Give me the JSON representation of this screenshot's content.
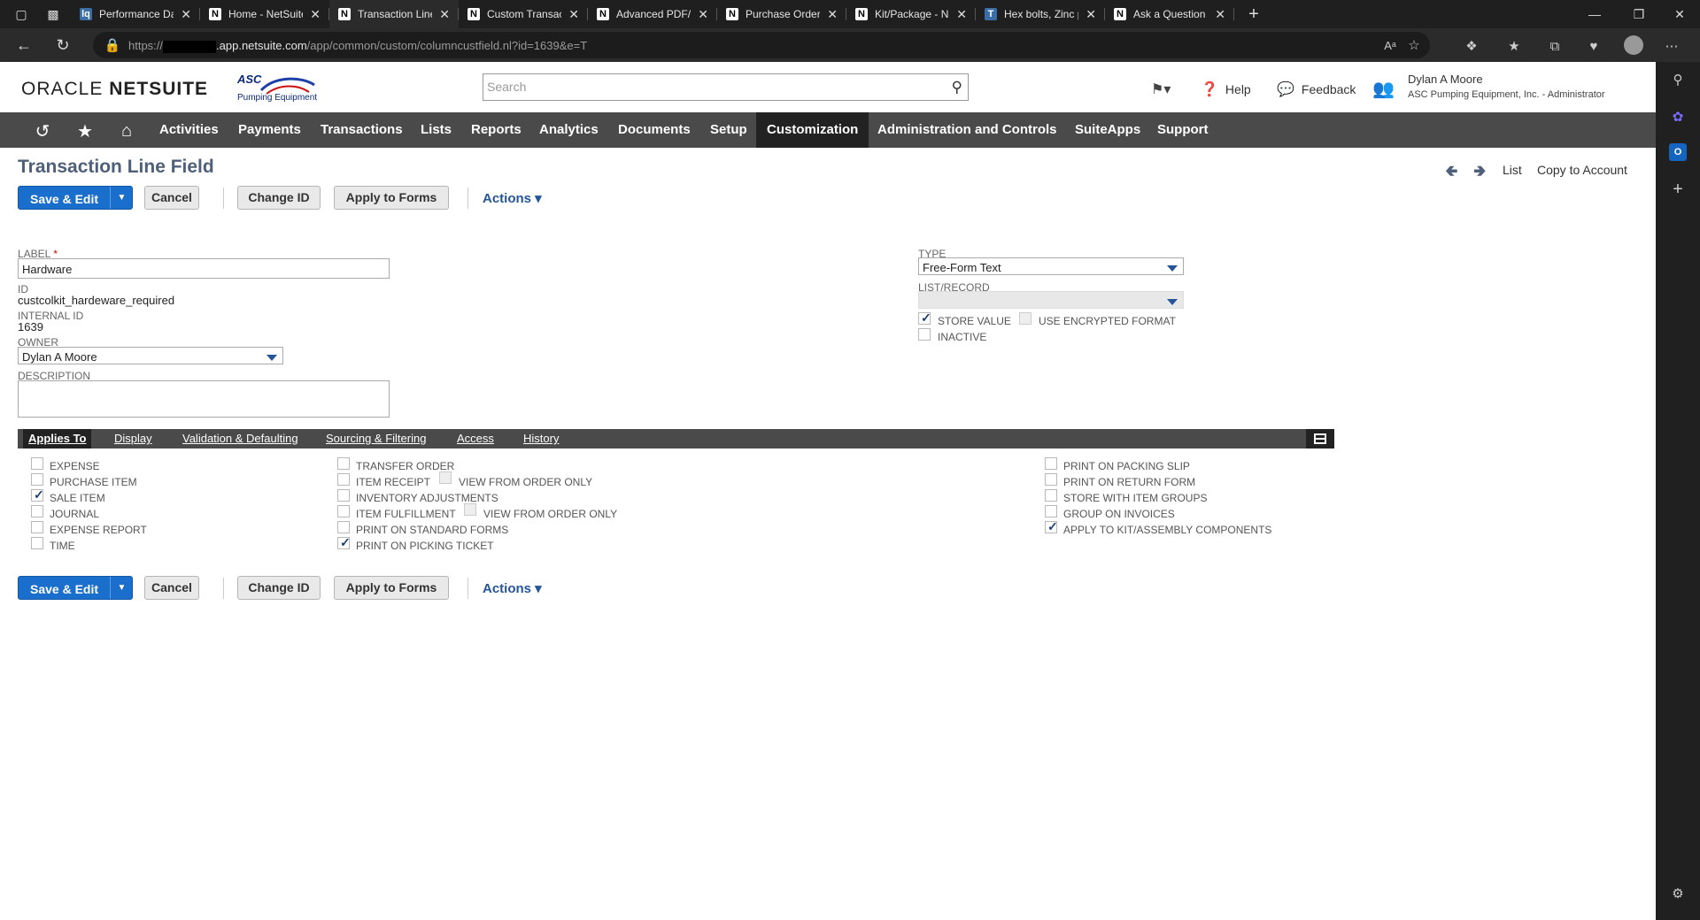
{
  "browser": {
    "tabs": [
      {
        "label": "Performance Datashe",
        "favicon": "lq",
        "active": false
      },
      {
        "label": "Home - NetSuite (ASC",
        "favicon": "N",
        "active": false
      },
      {
        "label": "Transaction Line Field",
        "favicon": "N",
        "active": true
      },
      {
        "label": "Custom Transaction F",
        "favicon": "N",
        "active": false
      },
      {
        "label": "Advanced PDF/HTML",
        "favicon": "N",
        "active": false
      },
      {
        "label": "Purchase Order - Net",
        "favicon": "N",
        "active": false
      },
      {
        "label": "Kit/Package - NetSuit",
        "favicon": "N",
        "active": false
      },
      {
        "label": "Hex bolts, Zinc plated",
        "favicon": "T",
        "active": false
      },
      {
        "label": "Ask a Question — Or",
        "favicon": "N",
        "active": false
      }
    ],
    "url_prefix": "https://",
    "url_host": ".app.netsuite.com",
    "url_path": "/app/common/custom/columncustfield.nl?id=1639&e=T"
  },
  "header": {
    "logo_oracle": "ORACLE",
    "logo_netsuite": "NETSUITE",
    "company_logo_line1": "ASC",
    "company_logo_line2": "Pumping Equipment",
    "search_placeholder": "Search",
    "help": "Help",
    "feedback": "Feedback",
    "user_name": "Dylan A Moore",
    "user_account": "ASC Pumping Equipment, Inc. - Administrator"
  },
  "nav": {
    "items": [
      "Activities",
      "Payments",
      "Transactions",
      "Lists",
      "Reports",
      "Analytics",
      "Documents",
      "Setup",
      "Customization",
      "Administration and Controls",
      "SuiteApps",
      "Support"
    ],
    "active": "Customization"
  },
  "page": {
    "title": "Transaction Line Field",
    "list_link": "List",
    "copy_link": "Copy to Account"
  },
  "buttons": {
    "save_edit": "Save & Edit",
    "cancel": "Cancel",
    "change_id": "Change ID",
    "apply_to_forms": "Apply to Forms",
    "actions": "Actions ▾"
  },
  "fields": {
    "label_label": "LABEL",
    "label_value": "Hardware",
    "id_label": "ID",
    "id_value": "custcolkit_hardeware_required",
    "internal_id_label": "INTERNAL ID",
    "internal_id_value": "1639",
    "owner_label": "OWNER",
    "owner_value": "Dylan A Moore",
    "description_label": "DESCRIPTION",
    "type_label": "TYPE",
    "type_value": "Free-Form Text",
    "list_record_label": "LIST/RECORD",
    "store_value_label": "STORE VALUE",
    "store_value_checked": true,
    "use_encrypted_label": "USE ENCRYPTED FORMAT",
    "use_encrypted_checked": false,
    "inactive_label": "INACTIVE",
    "inactive_checked": false
  },
  "subtabs": {
    "items": [
      "Applies To",
      "Display",
      "Validation & Defaulting",
      "Sourcing & Filtering",
      "Access",
      "History"
    ],
    "active": "Applies To"
  },
  "applies_to": {
    "col1": [
      {
        "label": "EXPENSE",
        "checked": false
      },
      {
        "label": "PURCHASE ITEM",
        "checked": false
      },
      {
        "label": "SALE ITEM",
        "checked": true
      },
      {
        "label": "JOURNAL",
        "checked": false
      },
      {
        "label": "EXPENSE REPORT",
        "checked": false
      },
      {
        "label": "TIME",
        "checked": false
      }
    ],
    "col2": [
      {
        "label": "TRANSFER ORDER",
        "checked": false
      },
      {
        "label": "ITEM RECEIPT",
        "checked": false
      },
      {
        "label": "INVENTORY ADJUSTMENTS",
        "checked": false
      },
      {
        "label": "ITEM FULFILLMENT",
        "checked": false
      },
      {
        "label": "PRINT ON STANDARD FORMS",
        "checked": false
      },
      {
        "label": "PRINT ON PICKING TICKET",
        "checked": true
      }
    ],
    "col2_sub": [
      {
        "label": "VIEW FROM ORDER ONLY",
        "checked": false
      },
      {
        "label": "VIEW FROM ORDER ONLY",
        "checked": false
      }
    ],
    "col3": [
      {
        "label": "PRINT ON PACKING SLIP",
        "checked": false
      },
      {
        "label": "PRINT ON RETURN FORM",
        "checked": false
      },
      {
        "label": "STORE WITH ITEM GROUPS",
        "checked": false
      },
      {
        "label": "GROUP ON INVOICES",
        "checked": false
      },
      {
        "label": "APPLY TO KIT/ASSEMBLY COMPONENTS",
        "checked": true
      }
    ]
  }
}
